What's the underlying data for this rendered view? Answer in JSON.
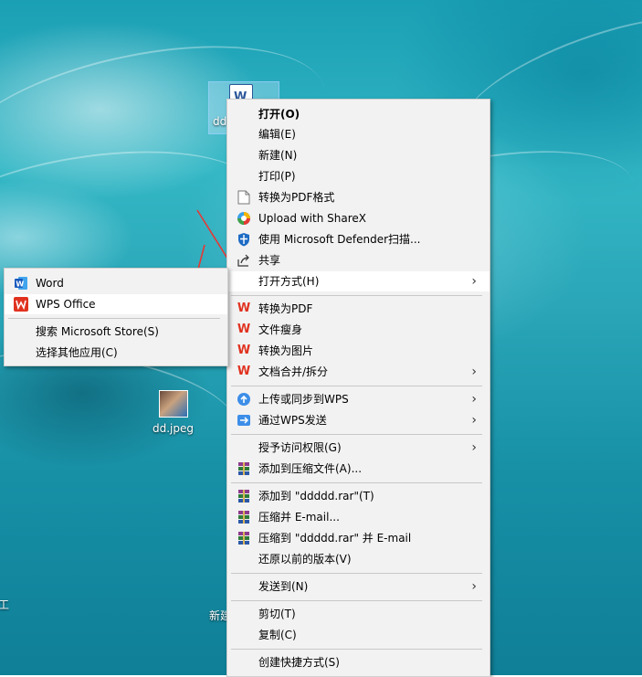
{
  "desktop": {
    "selected_icon_label": "dd",
    "jpeg_icon_label": "dd.jpeg",
    "partial_label_new": "新建",
    "partial_label_left": "工"
  },
  "context_menu": {
    "items": [
      {
        "label": "打开(O)",
        "bold": true
      },
      {
        "label": "编辑(E)"
      },
      {
        "label": "新建(N)"
      },
      {
        "label": "打印(P)"
      },
      {
        "label": "转换为PDF格式",
        "icon": "pdf-doc-icon"
      },
      {
        "label": "Upload with ShareX",
        "icon": "sharex-icon"
      },
      {
        "label": "使用 Microsoft Defender扫描...",
        "icon": "defender-shield-icon"
      },
      {
        "label": "共享",
        "icon": "share-icon"
      },
      {
        "label": "打开方式(H)",
        "submenu": true,
        "highlighted": true
      },
      {
        "label": "转换为PDF",
        "icon": "wps-icon"
      },
      {
        "label": "文件瘦身",
        "icon": "wps-icon"
      },
      {
        "label": "转换为图片",
        "icon": "wps-icon"
      },
      {
        "label": "文档合并/拆分",
        "icon": "wps-icon",
        "submenu": true
      },
      {
        "label": "上传或同步到WPS",
        "icon": "cloud-upload-icon",
        "submenu": true
      },
      {
        "label": "通过WPS发送",
        "icon": "send-arrow-icon",
        "submenu": true
      },
      {
        "label": "授予访问权限(G)",
        "submenu": true
      },
      {
        "label": "添加到压缩文件(A)...",
        "icon": "winrar-icon"
      },
      {
        "label": "添加到 \"ddddd.rar\"(T)",
        "icon": "winrar-icon"
      },
      {
        "label": "压缩并 E-mail...",
        "icon": "winrar-icon"
      },
      {
        "label": "压缩到 \"ddddd.rar\" 并 E-mail",
        "icon": "winrar-icon"
      },
      {
        "label": "还原以前的版本(V)"
      },
      {
        "label": "发送到(N)",
        "submenu": true
      },
      {
        "label": "剪切(T)"
      },
      {
        "label": "复制(C)"
      },
      {
        "label": "创建快捷方式(S)"
      }
    ],
    "submenu_arrow": "›"
  },
  "open_with_menu": {
    "items": [
      {
        "label": "Word",
        "icon": "word-icon"
      },
      {
        "label": "WPS Office",
        "icon": "wps-office-icon",
        "highlighted": true
      },
      {
        "label": "搜索 Microsoft Store(S)"
      },
      {
        "label": "选择其他应用(C)"
      }
    ]
  },
  "colors": {
    "menu_bg": "#f2f2f2",
    "highlight": "#ffffff",
    "wps_red": "#e0321f",
    "annotation_arrow": "#e53935"
  }
}
